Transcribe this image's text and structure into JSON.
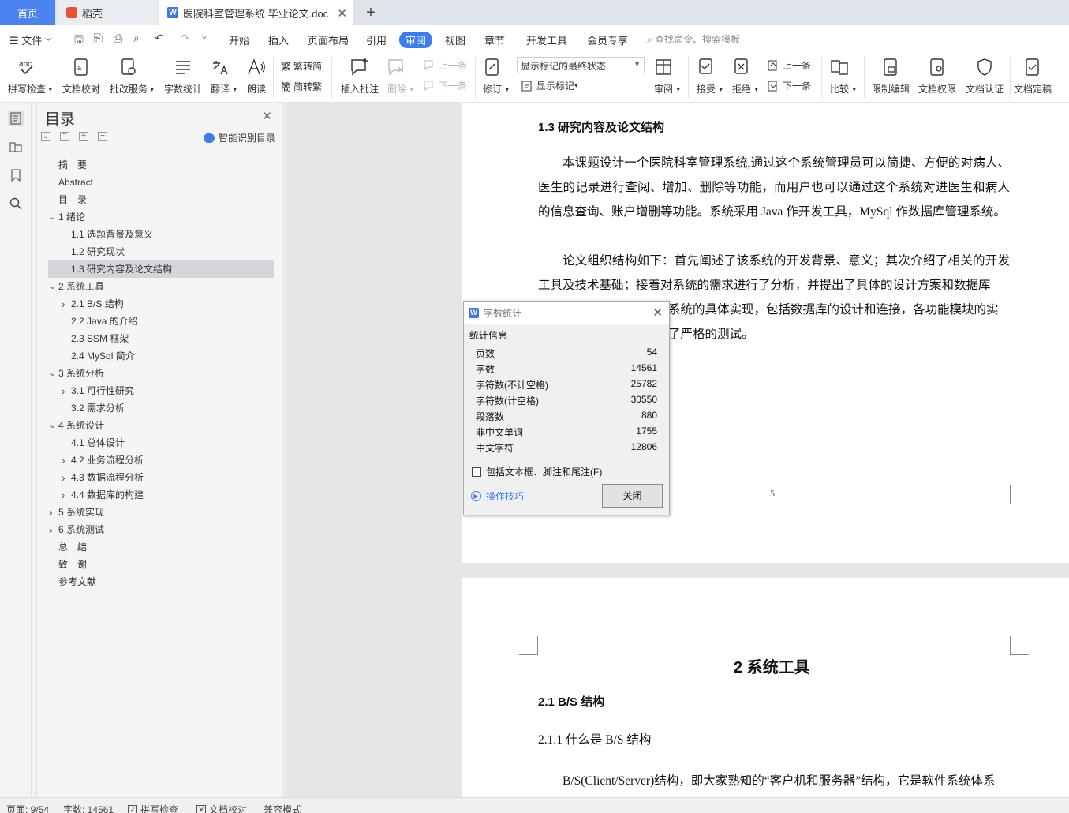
{
  "tabs": {
    "home": "首页",
    "daoke": "稻壳",
    "doc": "医院科室管理系统 毕业论文.doc"
  },
  "menu": {
    "file": "文件",
    "tabs": [
      "开始",
      "插入",
      "页面布局",
      "引用",
      "审阅",
      "视图",
      "章节",
      "开发工具",
      "会员专享"
    ],
    "active_tab": "审阅",
    "search": "查找命令、搜索模板"
  },
  "ribbon": {
    "spell": "拼写检查",
    "doc_check": "文档校对",
    "revise_service": "批改服务",
    "word_count": "字数统计",
    "translate": "翻译",
    "read_aloud": "朗读",
    "to_traditional": "繁转简",
    "to_simplified": "简转繁",
    "insert_comment": "插入批注",
    "delete": "删除",
    "prev_comment": "上一条",
    "next_comment": "下一条",
    "track": "修订",
    "show_markup_combo": "显示标记的最终状态",
    "show_markup": "显示标记",
    "review": "审阅",
    "accept": "接受",
    "reject": "拒绝",
    "prev_change": "上一条",
    "next_change": "下一条",
    "compare": "比较",
    "restrict": "限制编辑",
    "permission": "文档权限",
    "certify": "文档认证",
    "finalize": "文档定稿"
  },
  "toc": {
    "title": "目录",
    "smart": "智能识别目录",
    "items": [
      {
        "text": "摘　要",
        "level": 0,
        "expand": ""
      },
      {
        "text": "Abstract",
        "level": 0,
        "expand": ""
      },
      {
        "text": "目　录",
        "level": 0,
        "expand": ""
      },
      {
        "text": "1 绪论",
        "level": 0,
        "expand": "open"
      },
      {
        "text": "1.1 选题背景及意义",
        "level": 1,
        "expand": ""
      },
      {
        "text": "1.2 研究现状",
        "level": 1,
        "expand": ""
      },
      {
        "text": "1.3 研究内容及论文结构",
        "level": 1,
        "expand": "",
        "selected": true
      },
      {
        "text": "2 系统工具",
        "level": 0,
        "expand": "open"
      },
      {
        "text": "2.1 B/S 结构",
        "level": 1,
        "expand": "closed"
      },
      {
        "text": "2.2 Java 的介绍",
        "level": 1,
        "expand": ""
      },
      {
        "text": "2.3 SSM 框架",
        "level": 1,
        "expand": ""
      },
      {
        "text": "2.4 MySql 简介",
        "level": 1,
        "expand": ""
      },
      {
        "text": "3 系统分析",
        "level": 0,
        "expand": "open"
      },
      {
        "text": "3.1 可行性研究",
        "level": 1,
        "expand": "closed"
      },
      {
        "text": "3.2  需求分析",
        "level": 1,
        "expand": ""
      },
      {
        "text": "4 系统设计",
        "level": 0,
        "expand": "open"
      },
      {
        "text": "4.1  总体设计",
        "level": 1,
        "expand": ""
      },
      {
        "text": "4.2  业务流程分析",
        "level": 1,
        "expand": "closed"
      },
      {
        "text": "4.3 数据流程分析",
        "level": 1,
        "expand": "closed"
      },
      {
        "text": "4.4 数据库的构建",
        "level": 1,
        "expand": "closed"
      },
      {
        "text": "5 系统实现",
        "level": 0,
        "expand": "closed"
      },
      {
        "text": "6 系统测试",
        "level": 0,
        "expand": "closed"
      },
      {
        "text": "总　结",
        "level": 0,
        "expand": ""
      },
      {
        "text": "致　谢",
        "level": 0,
        "expand": ""
      },
      {
        "text": "参考文献",
        "level": 0,
        "expand": ""
      }
    ]
  },
  "doc": {
    "p1_heading": "1.3 研究内容及论文结构",
    "p1_para1": "本课题设计一个医院科室管理系统,通过这个系统管理员可以简捷、方便的对病人、医生的记录进行查阅、增加、删除等功能，而用户也可以通过这个系统对进医生和病人的信息查询、账户增删等功能。系统采用 Java 作开发工具，MySql 作数据库管理系统。",
    "p1_para2": "论文组织结构如下：首先阐述了该系统的开发背景、意义；其次介绍了相关的开发工具及技术基础；接着对系统的需求进行了分析，并提出了具体的设计方案和数据库",
    "p1_para2_line3": "系统的具体实现，包括数据库的设计和连接，各功能模块的实",
    "p1_para2_line4": "了严格的测试。",
    "page_number": "5",
    "p2_chapter": "2 系统工具",
    "p2_heading": "2.1 B/S 结构",
    "p2_sub": "2.1.1  什么是 B/S 结构",
    "p2_para": "B/S(Client/Server)结构，即大家熟知的“客户机和服务器”结构，它是软件系统体系"
  },
  "dialog": {
    "title": "字数统计",
    "section": "统计信息",
    "stats": [
      {
        "label": "页数",
        "value": "54"
      },
      {
        "label": "字数",
        "value": "14561"
      },
      {
        "label": "字符数(不计空格)",
        "value": "25782"
      },
      {
        "label": "字符数(计空格)",
        "value": "30550"
      },
      {
        "label": "段落数",
        "value": "880"
      },
      {
        "label": "非中文单词",
        "value": "1755"
      },
      {
        "label": "中文字符",
        "value": "12806"
      }
    ],
    "checkbox": "包括文本框、脚注和尾注(F)",
    "tips": "操作技巧",
    "close": "关闭"
  },
  "status": {
    "page": "页面: 9/54",
    "words": "字数: 14561",
    "spell": "拼写检查",
    "doc_check": "文档校对",
    "compat": "兼容模式"
  },
  "colors": {
    "accent": "#3d7cf0",
    "home_tab": "#4a82f0"
  }
}
